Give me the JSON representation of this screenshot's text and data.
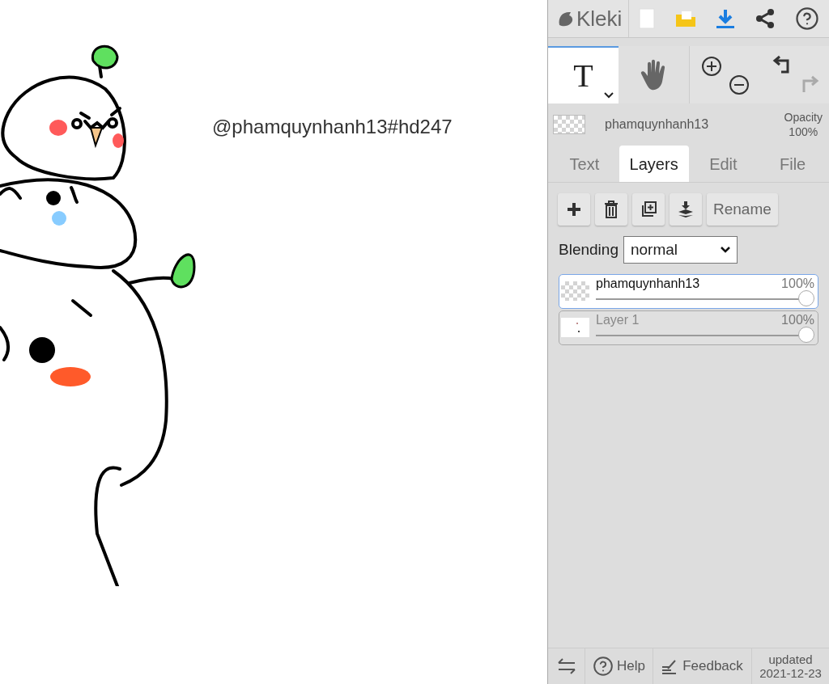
{
  "canvas": {
    "text": "@phamquynhanh13#hd247"
  },
  "header": {
    "logo": "Kleki"
  },
  "tools": [
    {
      "kind": "text",
      "label": "T",
      "selected": true
    },
    {
      "kind": "hand",
      "selected": false
    }
  ],
  "history": [
    {
      "kind": "undo",
      "disabled": false
    },
    {
      "kind": "redo",
      "disabled": true
    }
  ],
  "current_layer": {
    "name": "phamquynhanh13",
    "opacity_label": "Opacity",
    "opacity_value": "100%"
  },
  "tabs": [
    {
      "label": "Text",
      "selected": false
    },
    {
      "label": "Layers",
      "selected": true
    },
    {
      "label": "Edit",
      "selected": false
    },
    {
      "label": "File",
      "selected": false
    }
  ],
  "layer_actions": {
    "rename": "Rename"
  },
  "blending": {
    "label": "Blending",
    "value": "normal"
  },
  "layers": [
    {
      "name": "phamquynhanh13",
      "opacity": "100%",
      "level": 1,
      "selected": true,
      "kind": "transparent"
    },
    {
      "name": "Layer 1",
      "opacity": "100%",
      "level": 1,
      "selected": false,
      "kind": "white"
    }
  ],
  "footer": {
    "help": "Help",
    "feedback": "Feedback",
    "updated_label": "updated",
    "updated_date": "2021-12-23"
  }
}
